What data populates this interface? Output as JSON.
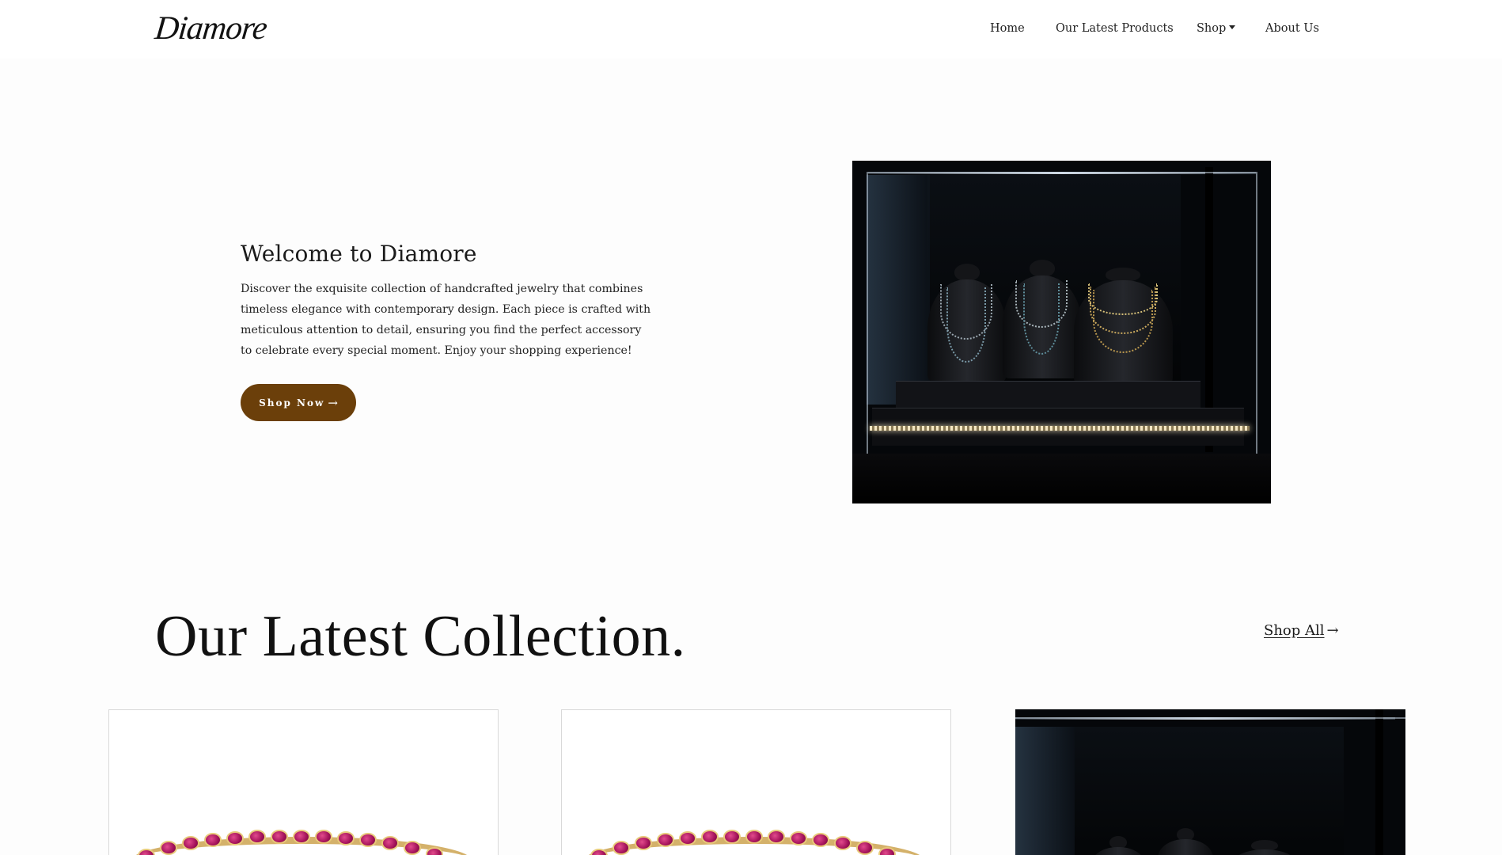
{
  "brand": {
    "logo_text": "Diamore"
  },
  "nav": {
    "home": "Home",
    "latest": "Our Latest Products",
    "shop": "Shop",
    "about": "About Us"
  },
  "hero": {
    "title": "Welcome to Diamore",
    "text": "Discover the exquisite collection of handcrafted jewelry that combines timeless elegance with contemporary design. Each piece is crafted with meticulous attention to detail, ensuring you find the perfect accessory to celebrate every special moment. Enjoy your shopping experience!",
    "cta_label": "Shop Now",
    "cta_arrow": "→"
  },
  "collection": {
    "title": "Our Latest Collection.",
    "shop_all_label": "Shop All",
    "shop_all_arrow": "→"
  },
  "colors": {
    "accent": "#6b3f0a",
    "background": "#fdfdfd",
    "text": "#1a1a1a"
  }
}
